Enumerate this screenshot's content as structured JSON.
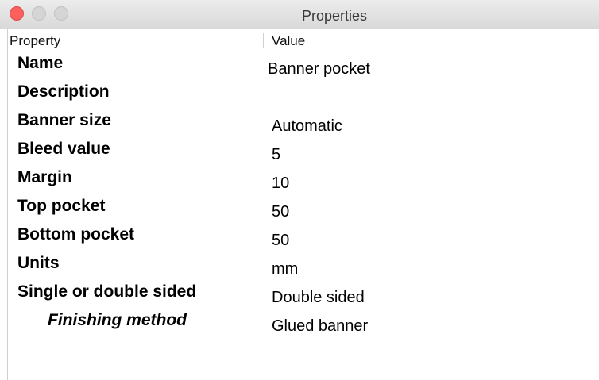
{
  "window": {
    "title": "Properties"
  },
  "table": {
    "headers": {
      "property": "Property",
      "value": "Value"
    },
    "rows": [
      {
        "name": "Name",
        "value": "Banner pocket"
      },
      {
        "name": "Description",
        "value": ""
      },
      {
        "name": "Banner size",
        "value": "Automatic"
      },
      {
        "name": "Bleed value",
        "value": "5"
      },
      {
        "name": "Margin",
        "value": "10"
      },
      {
        "name": "Top pocket",
        "value": "50"
      },
      {
        "name": "Bottom pocket",
        "value": "50"
      },
      {
        "name": "Units",
        "value": "mm"
      },
      {
        "name": "Single or double sided",
        "value": "Double sided"
      },
      {
        "name": "Finishing method",
        "value": "Glued banner"
      }
    ]
  },
  "colors": {
    "close_button": "#fc605c",
    "inactive_button": "#d5d5d5",
    "titlebar": "#e3e3e3"
  }
}
